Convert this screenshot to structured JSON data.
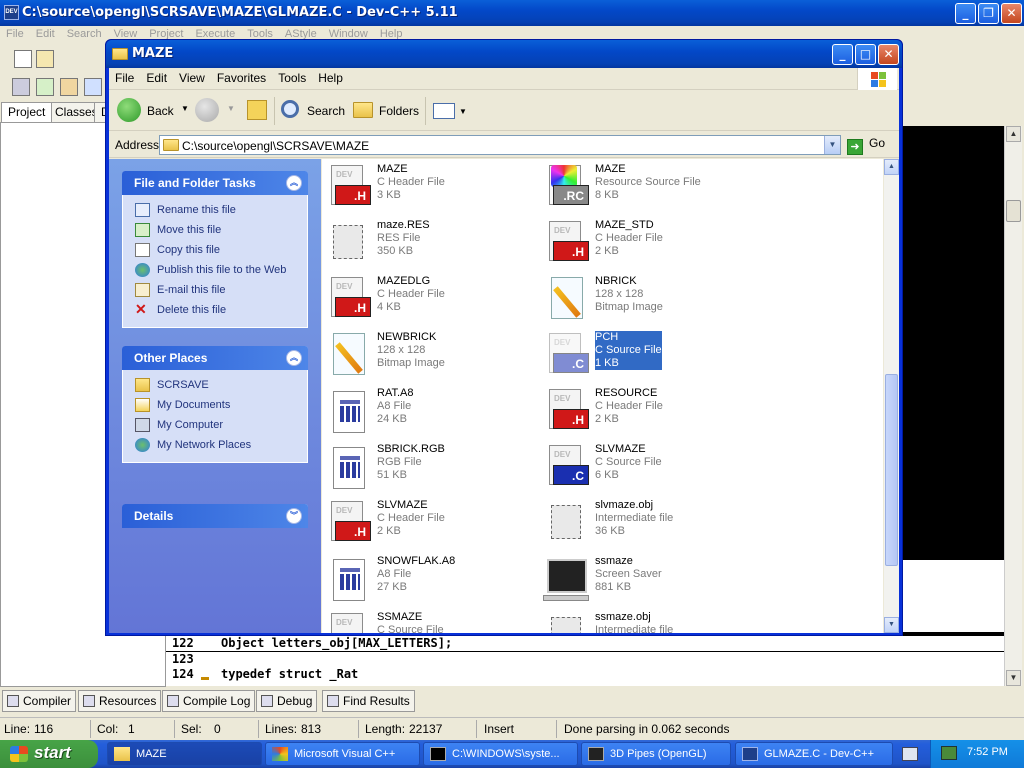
{
  "devcpp": {
    "title": "C:\\source\\opengl\\SCRSAVE\\MAZE\\GLMAZE.C - Dev-C++ 5.11",
    "menu": [
      "File",
      "Edit",
      "Search",
      "View",
      "Project",
      "Execute",
      "Tools",
      "AStyle",
      "Window",
      "Help"
    ],
    "left_tabs": [
      "Project",
      "Classes",
      "D"
    ],
    "code_lines": [
      {
        "num": "122",
        "text": "Object letters_obj[MAX_LETTERS];"
      },
      {
        "num": "123",
        "text": ""
      },
      {
        "num": "124",
        "text": "typedef struct _Rat"
      }
    ],
    "bottom_tabs": [
      "Compiler",
      "Resources",
      "Compile Log",
      "Debug",
      "Find Results"
    ],
    "status": {
      "line_label": "Line:",
      "line": "116",
      "col_label": "Col:",
      "col": "1",
      "sel_label": "Sel:",
      "sel": "0",
      "lines_label": "Lines:",
      "lines": "813",
      "length_label": "Length:",
      "length": "22137",
      "mode": "Insert",
      "message": "Done parsing in 0.062 seconds"
    }
  },
  "explorer": {
    "title": "MAZE",
    "menu": [
      "File",
      "Edit",
      "View",
      "Favorites",
      "Tools",
      "Help"
    ],
    "toolbar": {
      "back": "Back",
      "search": "Search",
      "folders": "Folders"
    },
    "address": {
      "label": "Address",
      "path": "C:\\source\\opengl\\SCRSAVE\\MAZE",
      "go": "Go"
    },
    "tasks": {
      "file_folder_title": "File and Folder Tasks",
      "file_folder_links": [
        "Rename this file",
        "Move this file",
        "Copy this file",
        "Publish this file to the Web",
        "E-mail this file",
        "Delete this file"
      ],
      "other_places_title": "Other Places",
      "other_places_links": [
        "SCRSAVE",
        "My Documents",
        "My Computer",
        "My Network Places"
      ],
      "details_title": "Details"
    },
    "files": [
      {
        "name": "MAZE",
        "type": "C Header File",
        "size": "3 KB",
        "icon": "h-file-icon"
      },
      {
        "name": "MAZE",
        "type": "Resource Source File",
        "size": "8 KB",
        "icon": "rc-file-icon"
      },
      {
        "name": "maze.RES",
        "type": "RES File",
        "size": "350 KB",
        "icon": "res-file-icon"
      },
      {
        "name": "MAZE_STD",
        "type": "C Header File",
        "size": "2 KB",
        "icon": "h-file-icon"
      },
      {
        "name": "MAZEDLG",
        "type": "C Header File",
        "size": "4 KB",
        "icon": "h-file-icon"
      },
      {
        "name": "NBRICK",
        "type": "128 x 128",
        "size": "Bitmap Image",
        "icon": "bitmap-icon"
      },
      {
        "name": "NEWBRICK",
        "type": "128 x 128",
        "size": "Bitmap Image",
        "icon": "bitmap-icon"
      },
      {
        "name": "PCH",
        "type": "C Source File",
        "size": "1 KB",
        "icon": "c-file-icon",
        "selected": true
      },
      {
        "name": "RAT.A8",
        "type": "A8 File",
        "size": "24 KB",
        "icon": "generic-file-icon"
      },
      {
        "name": "RESOURCE",
        "type": "C Header File",
        "size": "2 KB",
        "icon": "h-file-icon"
      },
      {
        "name": "SBRICK.RGB",
        "type": "RGB File",
        "size": "51 KB",
        "icon": "generic-file-icon"
      },
      {
        "name": "SLVMAZE",
        "type": "C Source File",
        "size": "6 KB",
        "icon": "c-file-icon"
      },
      {
        "name": "SLVMAZE",
        "type": "C Header File",
        "size": "2 KB",
        "icon": "h-file-icon"
      },
      {
        "name": "slvmaze.obj",
        "type": "Intermediate file",
        "size": "36 KB",
        "icon": "res-file-icon"
      },
      {
        "name": "SNOWFLAK.A8",
        "type": "A8 File",
        "size": "27 KB",
        "icon": "generic-file-icon"
      },
      {
        "name": "ssmaze",
        "type": "Screen Saver",
        "size": "881 KB",
        "icon": "screensaver-icon"
      },
      {
        "name": "SSMAZE",
        "type": "C Source File",
        "size": "",
        "icon": "c-file-icon"
      },
      {
        "name": "ssmaze.obj",
        "type": "Intermediate file",
        "size": "",
        "icon": "res-file-icon"
      }
    ]
  },
  "taskbar": {
    "start": "start",
    "tasks": [
      "MAZE",
      "Microsoft Visual C++",
      "C:\\WINDOWS\\syste...",
      "3D Pipes (OpenGL)",
      "GLMAZE.C - Dev-C++"
    ],
    "clock": "7:52 PM"
  }
}
